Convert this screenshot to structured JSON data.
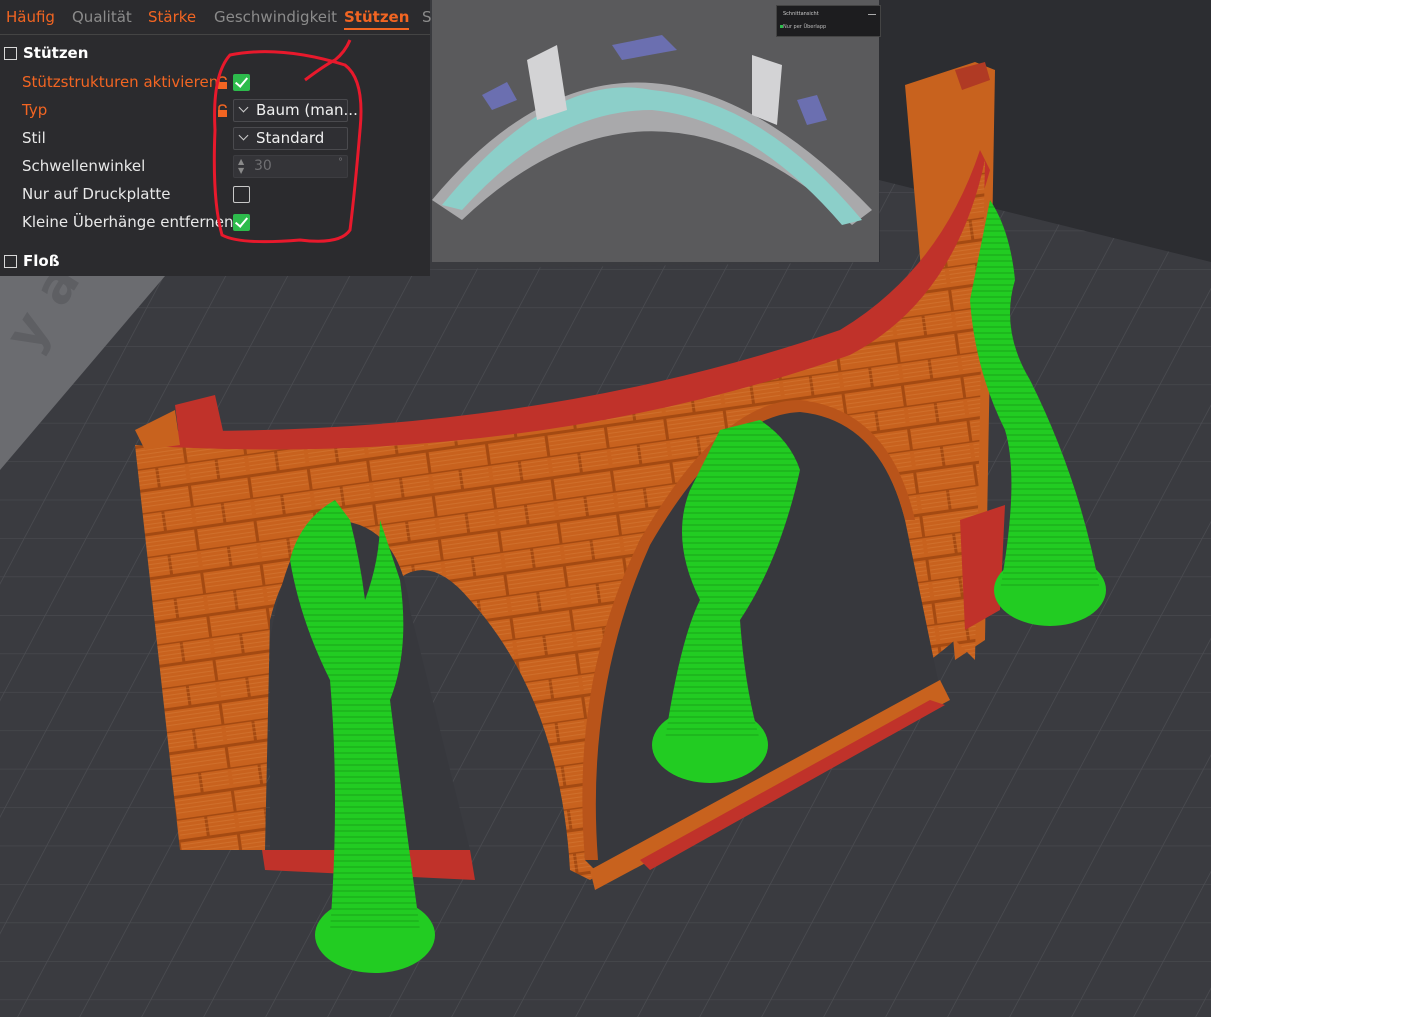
{
  "tabs": [
    "Häufig",
    "Qualität",
    "Stärke",
    "Geschwindigkeit",
    "Stützen",
    "S"
  ],
  "active_tab": "Stützen",
  "sections": {
    "support": {
      "title": "Stützen"
    },
    "raft": {
      "title": "Floß"
    }
  },
  "settings": {
    "enable_support": {
      "label": "Stützstrukturen aktivieren",
      "checked": true
    },
    "type": {
      "label": "Typ",
      "value": "Baum (man..."
    },
    "style": {
      "label": "Stil",
      "value": "Standard"
    },
    "threshold_angle": {
      "label": "Schwellenwinkel",
      "value": "30",
      "unit": "°"
    },
    "build_plate_only": {
      "label": "Nur auf Druckplatte",
      "checked": false
    },
    "remove_small_overhangs": {
      "label": "Kleine Überhänge entfernen",
      "checked": true
    }
  },
  "viewport": {
    "area_label": "y area"
  },
  "mini_panel": {
    "title": "Schnittansicht",
    "row": "Nur per Überlapp"
  },
  "colors": {
    "accent": "#f26522",
    "check": "#2dbb4c",
    "model_wall": "#c8621e",
    "model_top": "#c0322a",
    "support_tree": "#22cc22",
    "annotation": "#e8192c",
    "preview_model": "#8ccfc9"
  }
}
